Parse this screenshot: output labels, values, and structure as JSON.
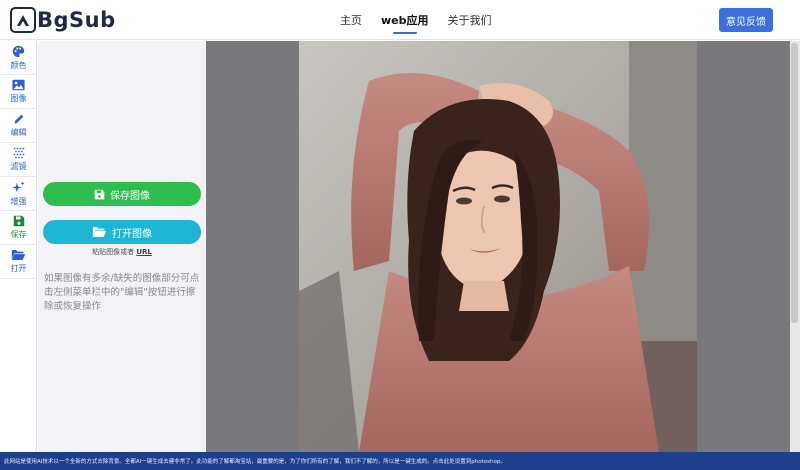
{
  "brand": {
    "logo_text": "BgSub"
  },
  "nav": {
    "items": [
      {
        "label": "主页"
      },
      {
        "label": "web应用"
      },
      {
        "label": "关于我们"
      }
    ],
    "feedback_label": "意见反馈"
  },
  "sidebar": {
    "items": [
      {
        "label": "颜色",
        "icon": "palette-icon"
      },
      {
        "label": "图像",
        "icon": "image-icon"
      },
      {
        "label": "编辑",
        "icon": "pencil-icon"
      },
      {
        "label": "滤镜",
        "icon": "filter-grid-icon"
      },
      {
        "label": "增强",
        "icon": "sparkles-icon"
      },
      {
        "label": "保存",
        "icon": "floppy-icon"
      },
      {
        "label": "打开",
        "icon": "folder-open-icon"
      }
    ]
  },
  "panel": {
    "save_label": "保存图像",
    "open_label": "打开图像",
    "paste_hint_prefix": "粘贴图像或者 ",
    "paste_hint_link": "URL",
    "hint": "如果图像有多余/缺失的图像部分可点击左侧菜单栏中的\"编辑\"按钮进行擦除或恢复操作"
  },
  "bottom": {
    "notice": "此网站是使用AI技术以一个全新的方式去除背景。全都AI一键生成去建非常了。此功能的了解都淘宝站，最重要的是，为了你们所有的了解，我们不了解的，所以是一键生成的。点击此处设置到photoshop。"
  },
  "colors": {
    "primary": "#3b6fe0",
    "save": "#2ebd4e",
    "open": "#1fb6d6",
    "sidebar_accent": "#2d5fd3",
    "canvas_bg": "#78787d",
    "bottom_bar": "#1e3f8c"
  }
}
